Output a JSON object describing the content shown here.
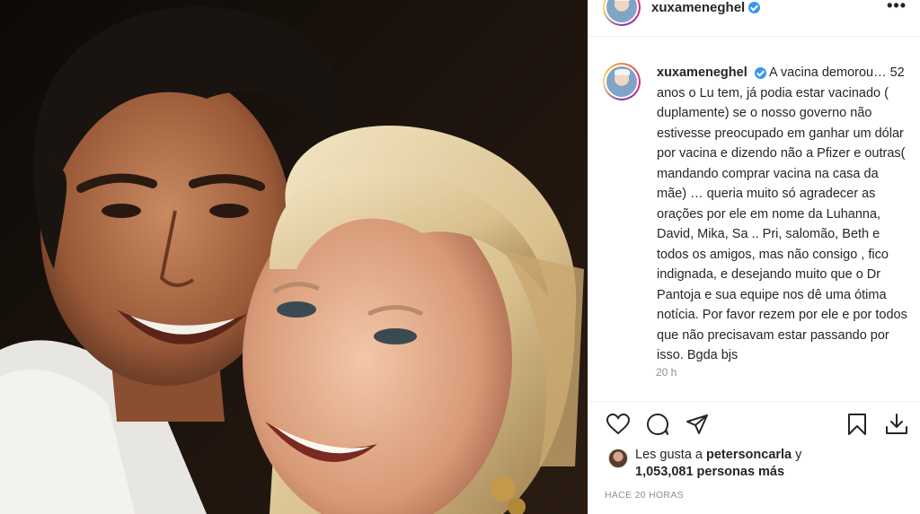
{
  "post": {
    "username": "xuxameneghel",
    "caption": "A vacina demorou… 52 anos o Lu tem, já podia estar vacinado ( duplamente) se o nosso governo não estivesse preocupado em ganhar um dólar por vacina e dizendo não a Pfizer e outras( mandando comprar vacina na casa da mãe) … queria muito só agradecer as orações por ele em nome da Luhanna, David, Mika, Sa .. Pri, salomão, Beth e todos os amigos, mas não consigo , fico indignada, e desejando muito que o Dr Pantoja e sua equipe nos dê uma ótima notícia. Por favor rezem por ele e por todos que não precisavam estar passando por isso. Bgda bjs",
    "caption_time": "20 h",
    "more_label": "•••"
  },
  "likes": {
    "prefix": "Les gusta a",
    "liker": "petersoncarla",
    "connector": "y",
    "count_text": "1,053,081 personas más"
  },
  "timestamp": "HACE 20 HORAS",
  "icons": {
    "like": "heart-icon",
    "comment": "comment-icon",
    "share": "share-icon",
    "save": "bookmark-icon",
    "download": "download-icon",
    "more": "more-icon",
    "verified": "verified-badge-icon"
  },
  "colors": {
    "text": "#262626",
    "secondary": "#8e8e8e",
    "verified": "#3897f0",
    "divider": "#efefef"
  }
}
